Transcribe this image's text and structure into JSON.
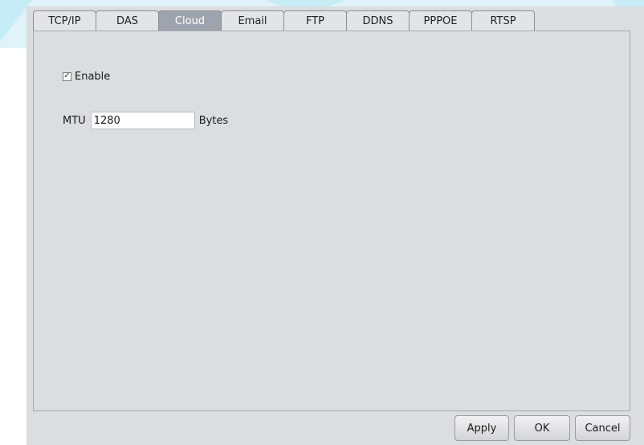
{
  "tabs": [
    {
      "label": "TCP/IP"
    },
    {
      "label": "DAS"
    },
    {
      "label": "Cloud"
    },
    {
      "label": "Email"
    },
    {
      "label": "FTP"
    },
    {
      "label": "DDNS"
    },
    {
      "label": "PPPOE"
    },
    {
      "label": "RTSP"
    }
  ],
  "active_tab": "Cloud",
  "enable": {
    "label": "Enable",
    "checked": true,
    "check_glyph": "✓"
  },
  "mtu": {
    "label": "MTU",
    "value": "1280",
    "unit": "Bytes"
  },
  "buttons": {
    "apply": "Apply",
    "ok": "OK",
    "cancel": "Cancel"
  },
  "colors": {
    "active_tab": "#9ea4ad",
    "panel": "#dcdde0",
    "background_accent": "#c6ecf5"
  }
}
